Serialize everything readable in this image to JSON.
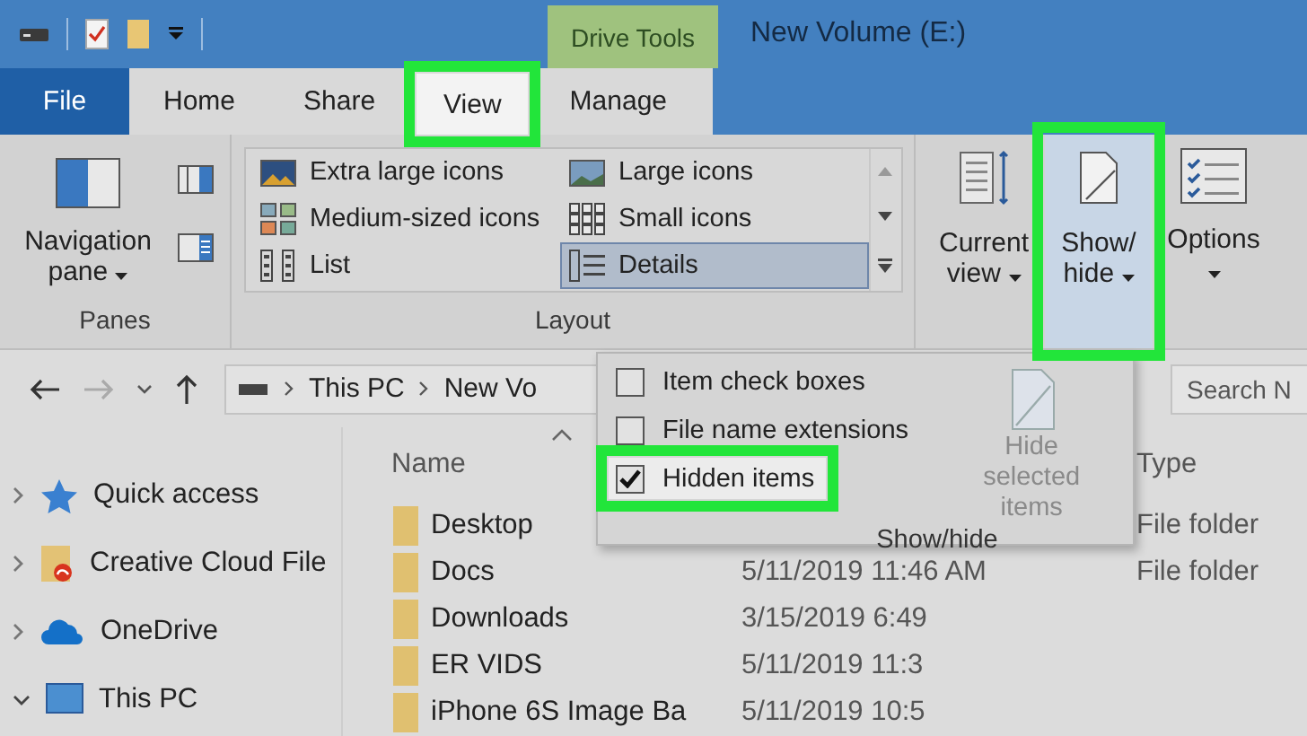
{
  "window": {
    "title": "New Volume (E:)"
  },
  "contextual_tab": {
    "label": "Drive Tools"
  },
  "tabs": [
    {
      "label": "File",
      "kind": "file",
      "selected": false,
      "highlighted": false
    },
    {
      "label": "Home",
      "kind": "tab",
      "selected": false,
      "highlighted": false
    },
    {
      "label": "Share",
      "kind": "tab",
      "selected": false,
      "highlighted": false
    },
    {
      "label": "View",
      "kind": "tab",
      "selected": true,
      "highlighted": true
    },
    {
      "label": "Manage",
      "kind": "tab",
      "selected": false,
      "highlighted": false
    }
  ],
  "panes_group": {
    "label": "Panes",
    "button": {
      "lines": [
        "Navigation",
        "pane"
      ]
    }
  },
  "layout_group": {
    "label": "Layout",
    "options": [
      {
        "label": "Extra large icons",
        "kind": "xl",
        "selected": false
      },
      {
        "label": "Large icons",
        "kind": "large",
        "selected": false
      },
      {
        "label": "Medium-sized icons",
        "kind": "medium",
        "selected": false
      },
      {
        "label": "Small icons",
        "kind": "small",
        "selected": false
      },
      {
        "label": "List",
        "kind": "list",
        "selected": false
      },
      {
        "label": "Details",
        "kind": "details",
        "selected": true
      }
    ]
  },
  "view_buttons": [
    {
      "lines": [
        "Current",
        "view"
      ],
      "kind": "current",
      "highlighted": false
    },
    {
      "lines": [
        "Show/",
        "hide"
      ],
      "kind": "showhide",
      "highlighted": true
    },
    {
      "lines": [
        "Options"
      ],
      "kind": "options",
      "highlighted": false
    }
  ],
  "address_bar": {
    "path": [
      "This PC",
      "New Vo"
    ]
  },
  "search": {
    "placeholder": "Search N"
  },
  "navigation_pane": {
    "items": [
      {
        "label": "Quick access",
        "kind": "star",
        "expanded": false
      },
      {
        "label": "Creative Cloud File",
        "kind": "cc",
        "expanded": false
      },
      {
        "label": "OneDrive",
        "kind": "cloud",
        "expanded": false
      },
      {
        "label": "This PC",
        "kind": "pc",
        "expanded": true
      }
    ]
  },
  "file_list": {
    "columns": {
      "name": "Name",
      "type": "Type"
    },
    "rows": [
      {
        "name": "Desktop",
        "type": "File folder"
      },
      {
        "name": "Docs",
        "date": "5/11/2019 11:46 AM",
        "type": "File folder"
      },
      {
        "name": "Downloads",
        "date": "3/15/2019 6:49"
      },
      {
        "name": "ER VIDS",
        "date": "5/11/2019 11:3"
      },
      {
        "name": "iPhone 6S Image Ba",
        "date": "5/11/2019 10:5"
      }
    ]
  },
  "show_hide_menu": {
    "label": "Show/hide",
    "options": [
      {
        "label": "Item check boxes",
        "checked": false,
        "highlighted": false
      },
      {
        "label": "File name extensions",
        "checked": false,
        "highlighted": false
      },
      {
        "label": "Hidden items",
        "checked": true,
        "highlighted": true
      }
    ],
    "hide_selected": {
      "label": "Hide selected items",
      "disabled": true
    }
  }
}
